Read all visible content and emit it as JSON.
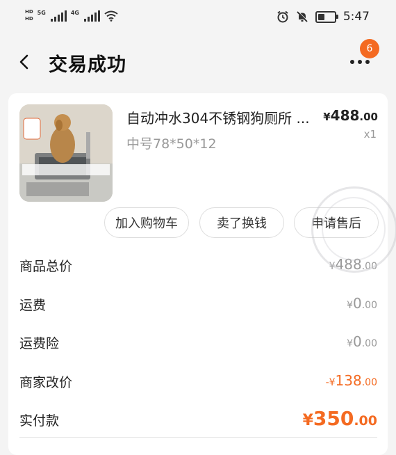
{
  "status_bar": {
    "sim1_tag": "HD",
    "sim2_tag": "HD",
    "net1": "5G",
    "net2": "4G",
    "time": "5:47",
    "battery_level": 0.35
  },
  "header": {
    "title": "交易成功",
    "more_badge": "6"
  },
  "product": {
    "name": "自动冲水304不锈钢狗厕所 ...",
    "spec": "中号78*50*12",
    "price_currency": "¥",
    "price_int": "488",
    "price_dec": ".00",
    "qty": "x1"
  },
  "actions": {
    "add_cart": "加入购物车",
    "sell": "卖了换钱",
    "after_sale": "申请售后"
  },
  "summary": {
    "goods_total_label": "商品总价",
    "goods_total_cur": "¥",
    "goods_total_int": "488",
    "goods_total_dec": ".00",
    "shipping_label": "运费",
    "shipping_cur": "¥",
    "shipping_int": "0",
    "shipping_dec": ".00",
    "insurance_label": "运费险",
    "insurance_cur": "¥",
    "insurance_int": "0",
    "insurance_dec": ".00",
    "adjust_label": "商家改价",
    "adjust_cur": "-¥",
    "adjust_int": "138",
    "adjust_dec": ".00",
    "paid_label": "实付款",
    "paid_cur": "¥",
    "paid_int": "350",
    "paid_dec": ".00"
  },
  "colors": {
    "accent": "#f46a21",
    "muted": "#999999"
  }
}
